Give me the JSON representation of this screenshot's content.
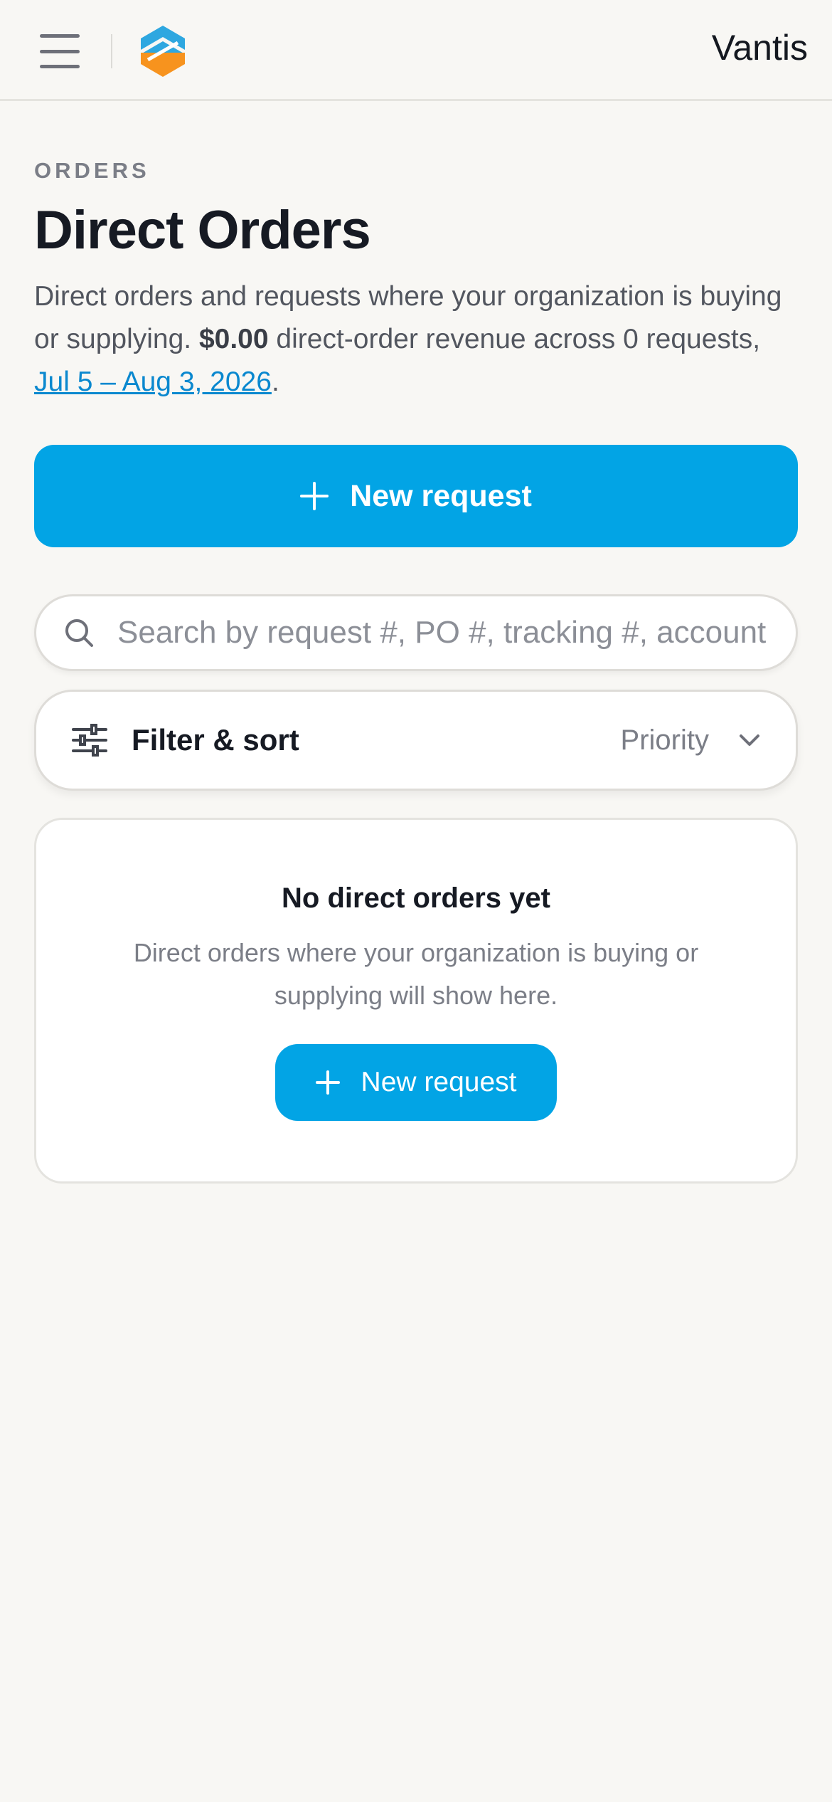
{
  "header": {
    "brand": "Vantis",
    "menu_icon": "hamburger-menu-icon",
    "logo_colors": {
      "primary": "#2ea7e0",
      "secondary": "#f7931e"
    }
  },
  "page": {
    "eyebrow": "ORDERS",
    "title": "Direct Orders",
    "desc_part1": "Direct orders and requests where your organization is buying or supplying. ",
    "revenue": "$0.00",
    "desc_part2": " direct-order revenue across 0 requests, ",
    "date_range": "Jul 5 – Aug 3, 2026",
    "desc_end": "."
  },
  "actions": {
    "new_request_label": "New request",
    "plus_icon": "plus-icon"
  },
  "search": {
    "placeholder": "Search by request #, PO #, tracking #, account",
    "icon": "search-icon"
  },
  "filter": {
    "label": "Filter & sort",
    "sort_value": "Priority",
    "icon": "sliders-icon",
    "chevron": "chevron-down-icon"
  },
  "empty_state": {
    "title": "No direct orders yet",
    "description": "Direct orders where your organization is buying or supplying will show here.",
    "button_label": "New request"
  },
  "colors": {
    "accent": "#02a4e5",
    "link": "#0a88cf",
    "background": "#f8f7f4"
  }
}
